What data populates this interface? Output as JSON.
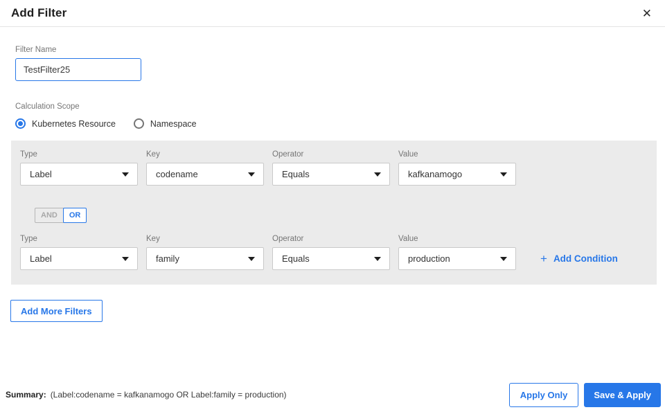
{
  "dialog": {
    "title": "Add Filter",
    "close_icon": "✕"
  },
  "filter_name": {
    "label": "Filter Name",
    "value": "TestFilter25"
  },
  "calculation_scope": {
    "label": "Calculation Scope",
    "options": [
      {
        "label": "Kubernetes Resource",
        "selected": true
      },
      {
        "label": "Namespace",
        "selected": false
      }
    ]
  },
  "conditions": {
    "column_labels": {
      "type": "Type",
      "key": "Key",
      "operator": "Operator",
      "value": "Value"
    },
    "rows": [
      {
        "type": "Label",
        "key": "codename",
        "operator": "Equals",
        "value": "kafkanamogo"
      },
      {
        "type": "Label",
        "key": "family",
        "operator": "Equals",
        "value": "production"
      }
    ],
    "logic_toggle": {
      "and_label": "AND",
      "or_label": "OR",
      "selected": "OR"
    },
    "plus_icon": "+",
    "add_condition_label": "Add Condition"
  },
  "add_more_filters_label": "Add More Filters",
  "footer": {
    "summary_label": "Summary:",
    "summary_text": "(Label:codename = kafkanamogo OR Label:family = production)",
    "apply_only_label": "Apply Only",
    "save_apply_label": "Save & Apply"
  },
  "colors": {
    "accent": "#2777e8",
    "panel_background": "#ebebeb"
  }
}
